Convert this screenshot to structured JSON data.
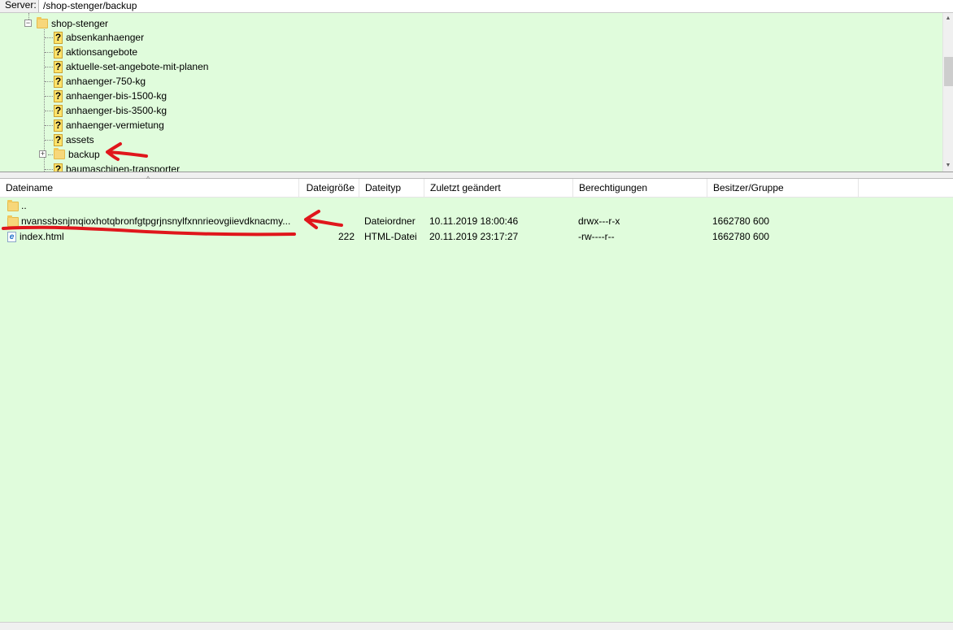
{
  "path_bar": {
    "label": "Server:",
    "value": "/shop-stenger/backup"
  },
  "tree": {
    "root": {
      "label": "shop-stenger",
      "icon": "folder-icon",
      "expanded": true
    },
    "items": [
      {
        "label": "absenkanhaenger",
        "icon": "question-icon"
      },
      {
        "label": "aktionsangebote",
        "icon": "question-icon"
      },
      {
        "label": "aktuelle-set-angebote-mit-planen",
        "icon": "question-icon"
      },
      {
        "label": "anhaenger-750-kg",
        "icon": "question-icon"
      },
      {
        "label": "anhaenger-bis-1500-kg",
        "icon": "question-icon"
      },
      {
        "label": "anhaenger-bis-3500-kg",
        "icon": "question-icon"
      },
      {
        "label": "anhaenger-vermietung",
        "icon": "question-icon"
      },
      {
        "label": "assets",
        "icon": "question-icon"
      },
      {
        "label": "backup",
        "icon": "folder-icon",
        "expander": "+"
      },
      {
        "label": "baumaschinen-transporter",
        "icon": "question-icon"
      }
    ]
  },
  "file_list": {
    "columns": [
      "Dateiname",
      "Dateigröße",
      "Dateityp",
      "Zuletzt geändert",
      "Berechtigungen",
      "Besitzer/Gruppe"
    ],
    "rows": [
      {
        "name": "..",
        "size": "",
        "type": "",
        "modified": "",
        "permissions": "",
        "owner": "",
        "icon": "folder-icon"
      },
      {
        "name": "nvanssbsnjmqioxhotqbronfgtpgrjnsnylfxnnrieovgiievdknacmy...",
        "size": "",
        "type": "Dateiordner",
        "modified": "10.11.2019 18:00:46",
        "permissions": "drwx---r-x",
        "owner": "1662780 600",
        "icon": "folder-icon"
      },
      {
        "name": "index.html",
        "size": "222",
        "type": "HTML-Datei",
        "modified": "20.11.2019 23:17:27",
        "permissions": "-rw----r--",
        "owner": "1662780 600",
        "icon": "html-file-icon"
      }
    ]
  },
  "colors": {
    "background_green": "#e0fcdc",
    "annotation_red": "#e0161c"
  }
}
